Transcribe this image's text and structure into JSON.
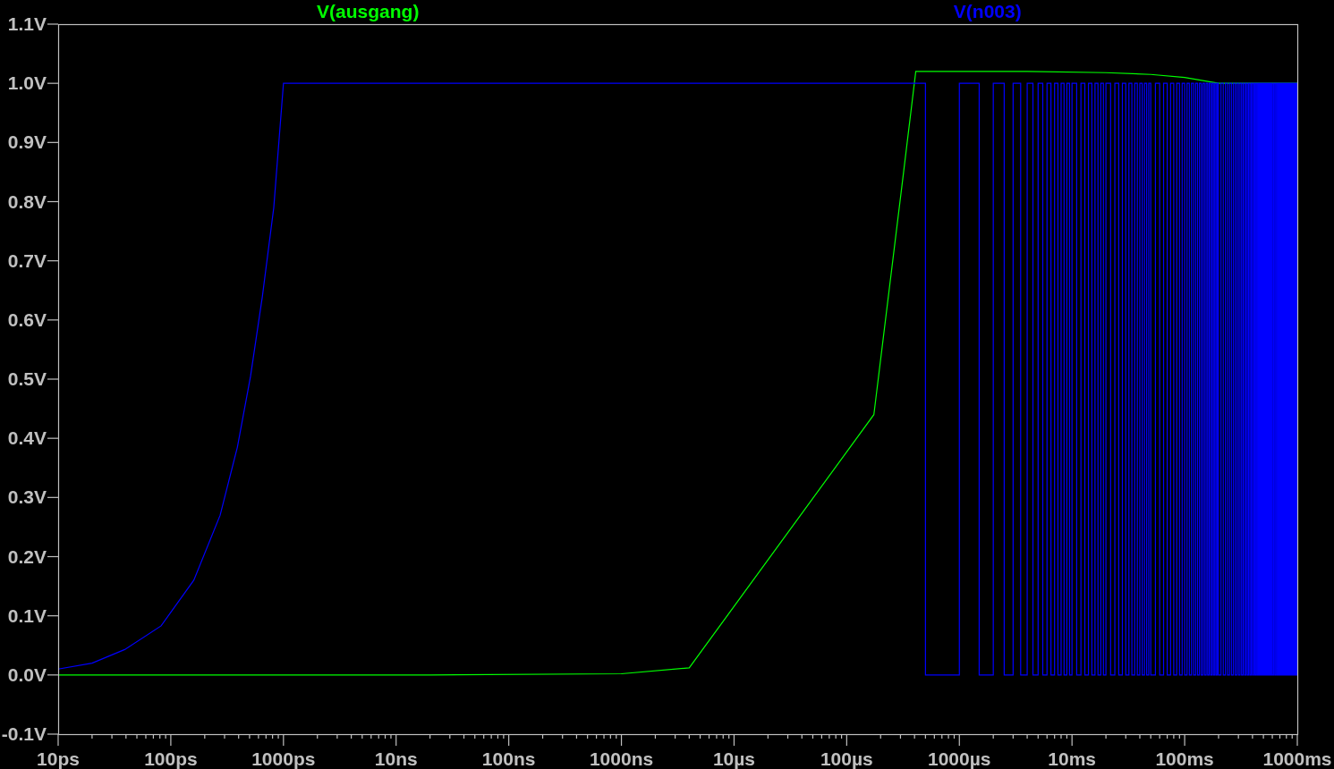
{
  "plot": {
    "traces": [
      {
        "name": "V(ausgang)",
        "color": "#00ff00"
      },
      {
        "name": "V(n003)",
        "color": "#0000ff"
      }
    ],
    "y_axis_labels": [
      "1.1V",
      "1.0V",
      "0.9V",
      "0.8V",
      "0.7V",
      "0.6V",
      "0.5V",
      "0.4V",
      "0.3V",
      "0.2V",
      "0.1V",
      "0.0V",
      "-0.1V"
    ],
    "x_axis_labels": [
      "10ps",
      "100ps",
      "1000ps",
      "10ns",
      "100ns",
      "1000ns",
      "10µs",
      "100µs",
      "1000µs",
      "10ms",
      "100ms",
      "1000ms"
    ]
  }
}
